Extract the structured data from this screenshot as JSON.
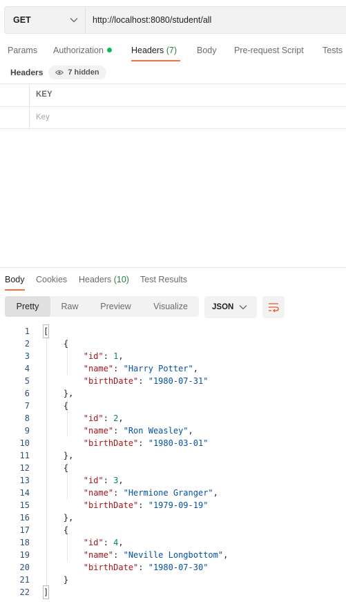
{
  "request": {
    "method": "GET",
    "url": "http://localhost:8080/student/all"
  },
  "request_tabs": {
    "params": "Params",
    "authorization": "Authorization",
    "headers": "Headers",
    "headers_count": "(7)",
    "body": "Body",
    "pre_request": "Pre-request Script",
    "tests": "Tests"
  },
  "headers_panel": {
    "label": "Headers",
    "hidden_label": "7 hidden",
    "column_key": "KEY",
    "key_placeholder": "Key"
  },
  "response_tabs": {
    "body": "Body",
    "cookies": "Cookies",
    "headers": "Headers",
    "headers_count": "(10)",
    "test_results": "Test Results"
  },
  "view_options": [
    "Pretty",
    "Raw",
    "Preview",
    "Visualize"
  ],
  "format": "JSON",
  "response_body": [
    {
      "id": 1,
      "name": "Harry Potter",
      "birthDate": "1980-07-31"
    },
    {
      "id": 2,
      "name": "Ron Weasley",
      "birthDate": "1980-03-01"
    },
    {
      "id": 3,
      "name": "Hermione Granger",
      "birthDate": "1979-09-19"
    },
    {
      "id": 4,
      "name": "Neville Longbottom",
      "birthDate": "1980-07-30"
    }
  ],
  "colors": {
    "accent": "#ff6c37",
    "status_dot": "#0cbb52",
    "count": "#2a7d46"
  },
  "icons": {
    "method_dropdown": "chevron-down-icon",
    "hidden_headers": "eye-icon",
    "format_dropdown": "chevron-down-icon",
    "wrap": "wrap-lines-icon"
  }
}
